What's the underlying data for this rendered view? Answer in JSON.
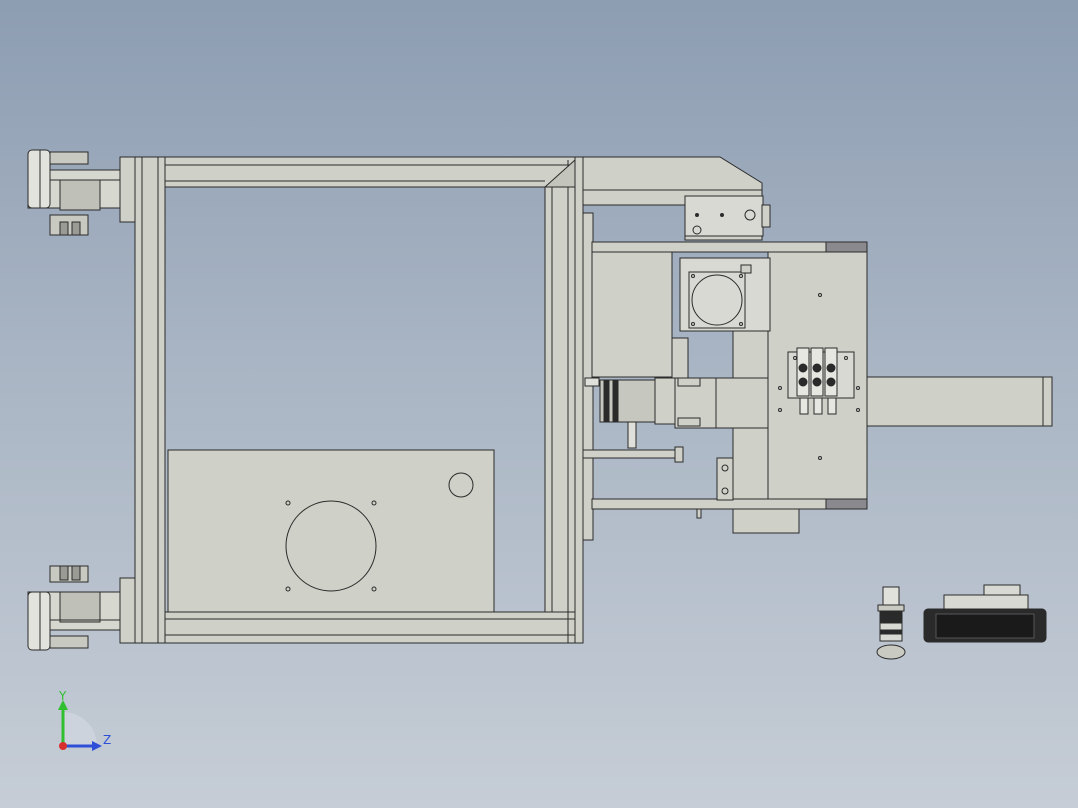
{
  "viewport": {
    "background_top": "#8d9db2",
    "background_bottom": "#c6cdd6"
  },
  "model": {
    "part_fill": "#cfd0c8",
    "part_fill_dark": "#b9bab2",
    "edge_color": "#2b2b2b",
    "accent_dark": "#2a2a2a",
    "gray_pad": "#8a8a8e"
  },
  "triad": {
    "y_label": "Y",
    "z_label": "Z",
    "y_color": "#2fbf2f",
    "z_color": "#2f4fd8",
    "x_color": "#d82f2f",
    "icon": "coordinate-triad-icon"
  }
}
